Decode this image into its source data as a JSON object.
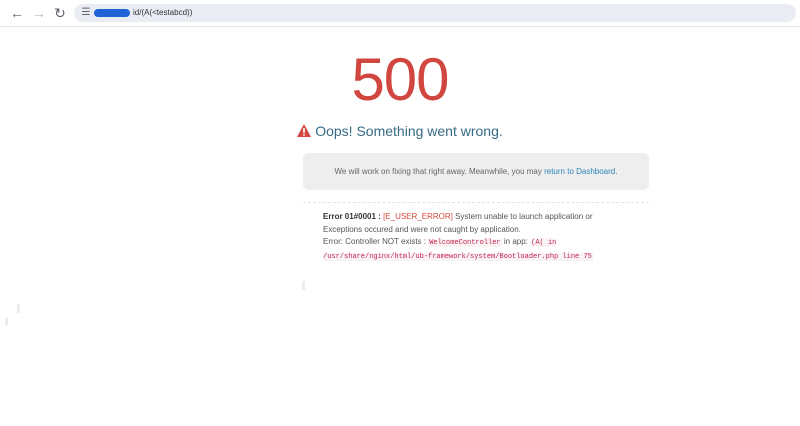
{
  "browser": {
    "url_text": "id/(A(<testabcd))"
  },
  "error_page": {
    "code": "500",
    "headline": "Oops! Something went wrong.",
    "message_prefix": "We will work on fixing that right away. Meanwhile, you may",
    "link_text": "return to Dashboard",
    "message_suffix": ".",
    "error_label": "Error 01#0001 :",
    "error_type": "[E_USER_ERROR]",
    "error_text_1": "System unable to launch application or Exceptions occured and were not caught by application.",
    "error_text_2": "Error: Controller NOT exists :",
    "controller_code": "WelcomeController",
    "in_app_text": "in app:",
    "app_code": "(A( in /usr/share/nginx/html/ub-framework/system/Bootloader.php line 75"
  },
  "colors": {
    "error_red": "#d1463f",
    "headline_blue": "#376a85",
    "link_blue": "#2a84b8"
  }
}
